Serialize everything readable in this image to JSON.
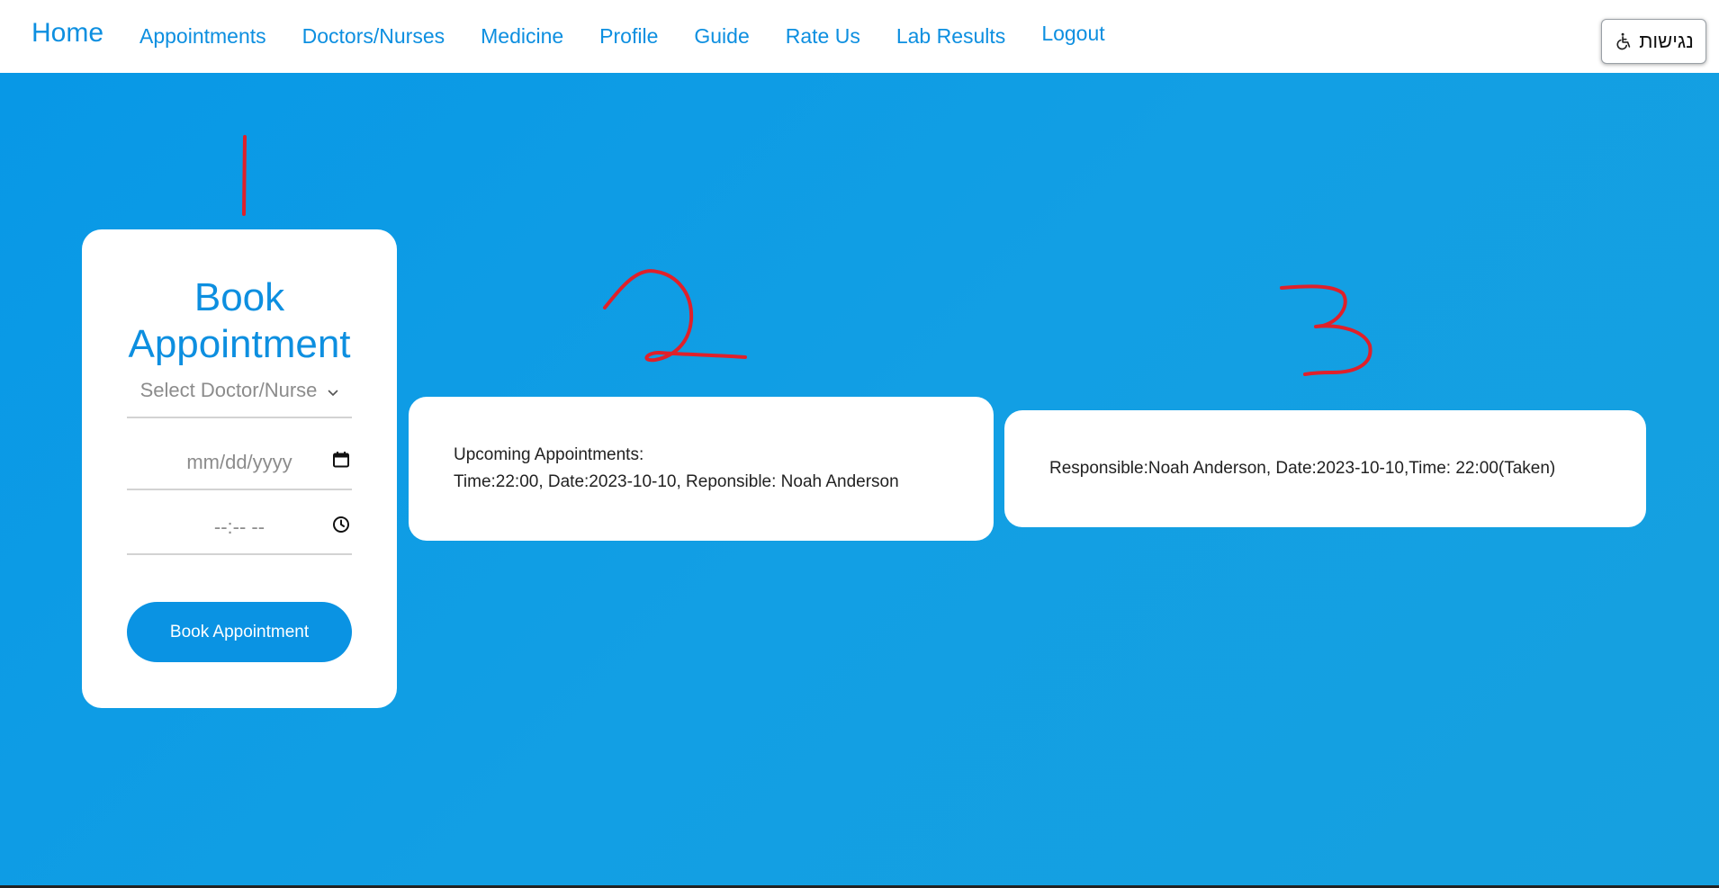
{
  "nav": {
    "home": "Home",
    "links": [
      "Appointments",
      "Doctors/Nurses",
      "Medicine",
      "Profile",
      "Guide",
      "Rate Us",
      "Lab Results",
      "Logout"
    ],
    "accessibility_label": "נגישות",
    "accessibility_icon": "wheelchair-icon"
  },
  "booking": {
    "title": "Book Appointment",
    "doctor_select_placeholder": "Select Doctor/Nurse",
    "date_placeholder": "mm/dd/yyyy",
    "time_placeholder": "--:-- --",
    "submit_label": "Book Appointment"
  },
  "upcoming": {
    "heading": "Upcoming Appointments:",
    "entry": "Time:22:00, Date:2023-10-10, Reponsible: Noah Anderson"
  },
  "taken": {
    "entry": "Responsible:Noah Anderson, Date:2023-10-10,Time: 22:00(Taken)"
  },
  "annotations": {
    "marker_1": "1",
    "marker_2": "2",
    "marker_3": "3",
    "color": "#e0202a"
  },
  "colors": {
    "brand_blue": "#0d8fe0",
    "background_blue": "#0a98e6",
    "button_blue": "#0a93e3"
  }
}
